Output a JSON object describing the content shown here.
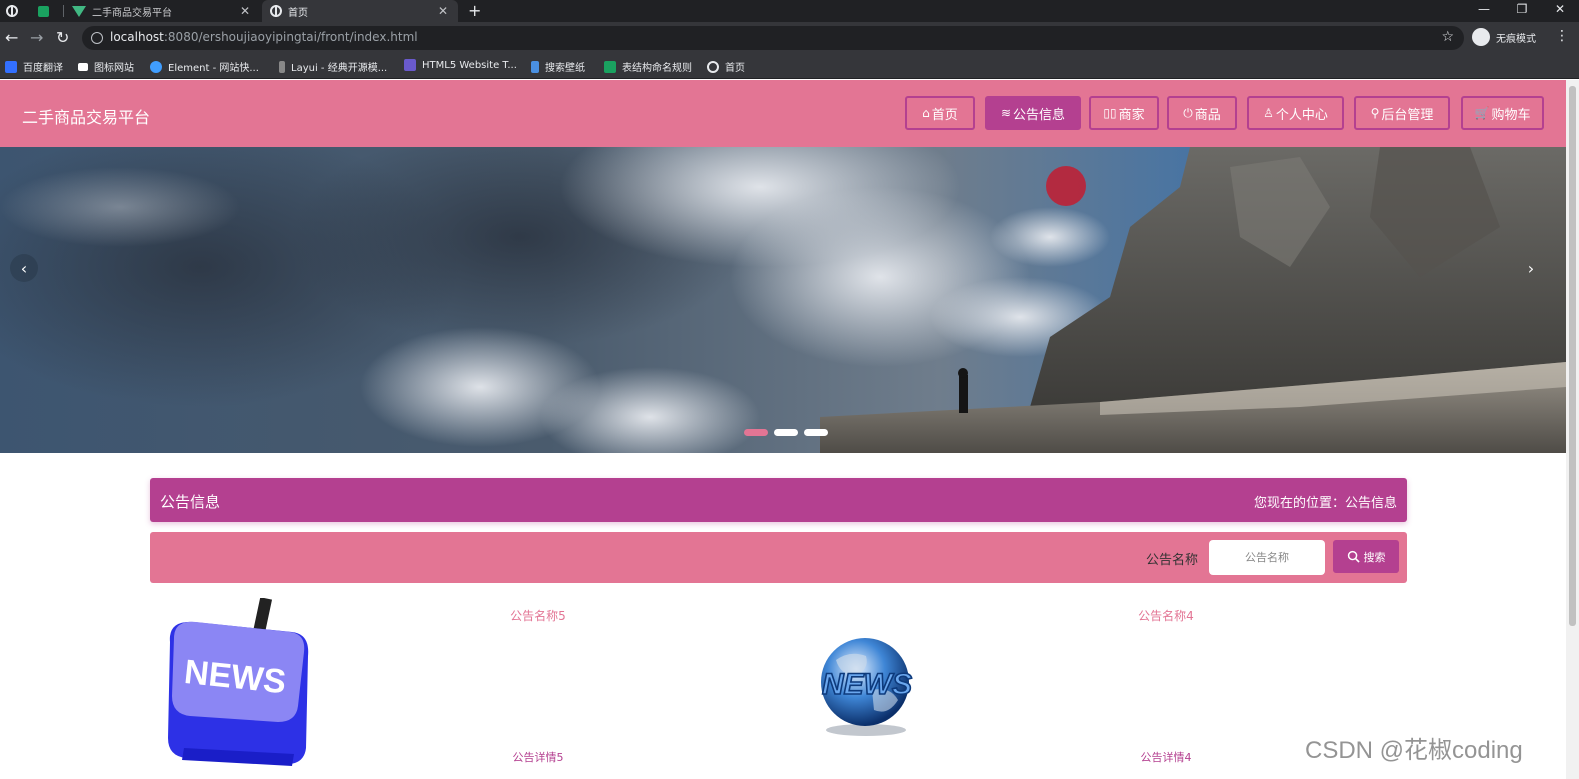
{
  "browser": {
    "tabs": [
      {
        "title": "二手商品交易平台",
        "active": false
      },
      {
        "title": "首页",
        "active": true
      }
    ],
    "new_tab_label": "+",
    "url_host": "localhost",
    "url_rest": ":8080/ershoujiaoyipingtai/front/index.html",
    "incognito_label": "无痕模式",
    "bookmarks": [
      {
        "label": "百度翻译",
        "icon": "translate-icon",
        "color": "#3370ff"
      },
      {
        "label": "图标网站",
        "icon": "flag-icon",
        "color": "#ffffff"
      },
      {
        "label": "Element - 网站快...",
        "icon": "element-icon",
        "color": "#409eff"
      },
      {
        "label": "Layui - 经典开源模...",
        "icon": "layui-icon",
        "color": "#888888"
      },
      {
        "label": "HTML5 Website T...",
        "icon": "html5-icon",
        "color": "#6a5acd"
      },
      {
        "label": "搜索壁纸",
        "icon": "wallpaper-icon",
        "color": "#4a90e2"
      },
      {
        "label": "表结构命名规则",
        "icon": "table-icon",
        "color": "#1aa260"
      },
      {
        "label": "首页",
        "icon": "globe-icon",
        "color": "#e8eaed"
      }
    ]
  },
  "header": {
    "site_title": "二手商品交易平台",
    "nav": [
      {
        "icon": "⌂",
        "label": "首页",
        "active": false
      },
      {
        "icon": "≋",
        "label": "公告信息",
        "active": true
      },
      {
        "icon": "▯▯",
        "label": "商家",
        "active": false
      },
      {
        "icon": "⏻",
        "label": "商品",
        "active": false
      },
      {
        "icon": "♙",
        "label": "个人中心",
        "active": false
      },
      {
        "icon": "⚲",
        "label": "后台管理",
        "active": false
      },
      {
        "icon": "🛒",
        "label": "购物车",
        "active": false
      }
    ]
  },
  "carousel": {
    "prev_symbol": "‹",
    "next_symbol": "›",
    "slide_count": 3,
    "active_index": 0
  },
  "breadcrumb": {
    "title": "公告信息",
    "location": "您现在的位置：公告信息"
  },
  "search": {
    "label": "公告名称",
    "placeholder": "公告名称",
    "button_label": "搜索"
  },
  "news": [
    {
      "title": "公告名称5",
      "detail": "公告详情5",
      "image": "news-key-image"
    },
    {
      "title": "公告名称4",
      "detail": "公告详情4",
      "image": "news-globe-image"
    }
  ],
  "colors": {
    "primary": "#e37594",
    "accent": "#b44090"
  },
  "watermark": "CSDN @花椒coding"
}
